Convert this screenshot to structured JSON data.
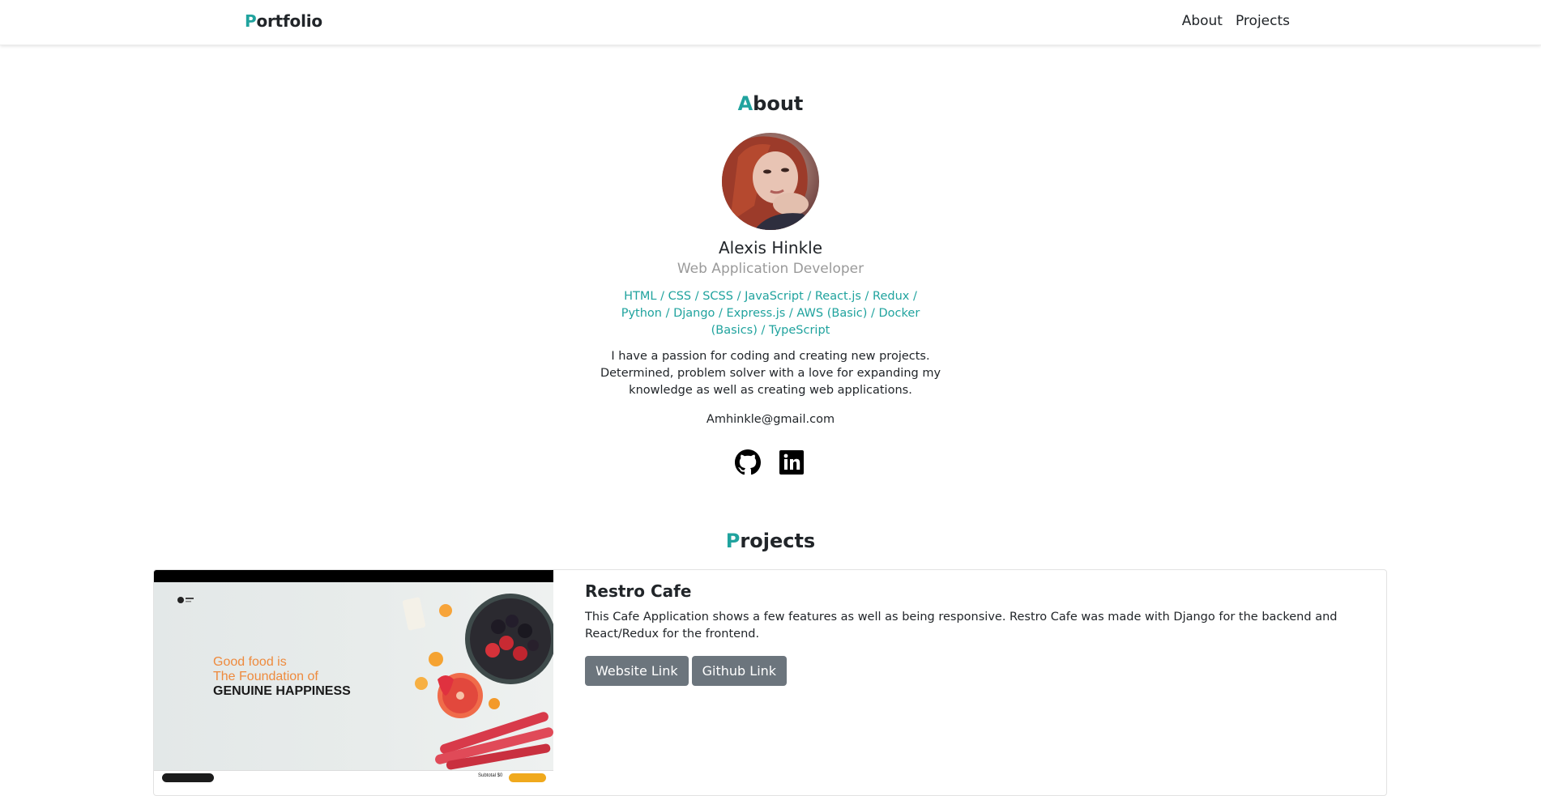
{
  "navbar": {
    "brand_first_letter": "P",
    "brand_rest": "ortfolio",
    "links": [
      "About",
      "Projects"
    ]
  },
  "colors": {
    "accent": "#20a39e",
    "button": "#6c757d",
    "muted": "#9a9a9a"
  },
  "about": {
    "title_first_letter": "A",
    "title_rest": "bout",
    "name": "Alexis Hinkle",
    "role": "Web Application Developer",
    "skills": "HTML / CSS / SCSS / JavaScript / React.js / Redux / Python / Django / Express.js / AWS (Basic) / Docker (Basics) / TypeScript",
    "bio": "I have a passion for coding and creating new projects. Determined, problem solver with a love for expanding my knowledge as well as creating web applications.",
    "email": "Amhinkle@gmail.com",
    "socials": [
      {
        "name": "github-icon"
      },
      {
        "name": "linkedin-icon"
      }
    ]
  },
  "projects": {
    "title_first_letter": "P",
    "title_rest": "rojects",
    "items": [
      {
        "title": "Restro Cafe",
        "description": "This Cafe Application shows a few features as well as being responsive. Restro Cafe was made with Django for the backend and React/Redux for the frontend.",
        "website_label": "Website Link",
        "github_label": "Github Link",
        "thumbnail": {
          "headline_line1": "Good food is",
          "headline_line2": "The Foundation of",
          "headline_line3": "GENUINE HAPPINESS",
          "subtotal": "Subtotal $0"
        }
      }
    ]
  }
}
